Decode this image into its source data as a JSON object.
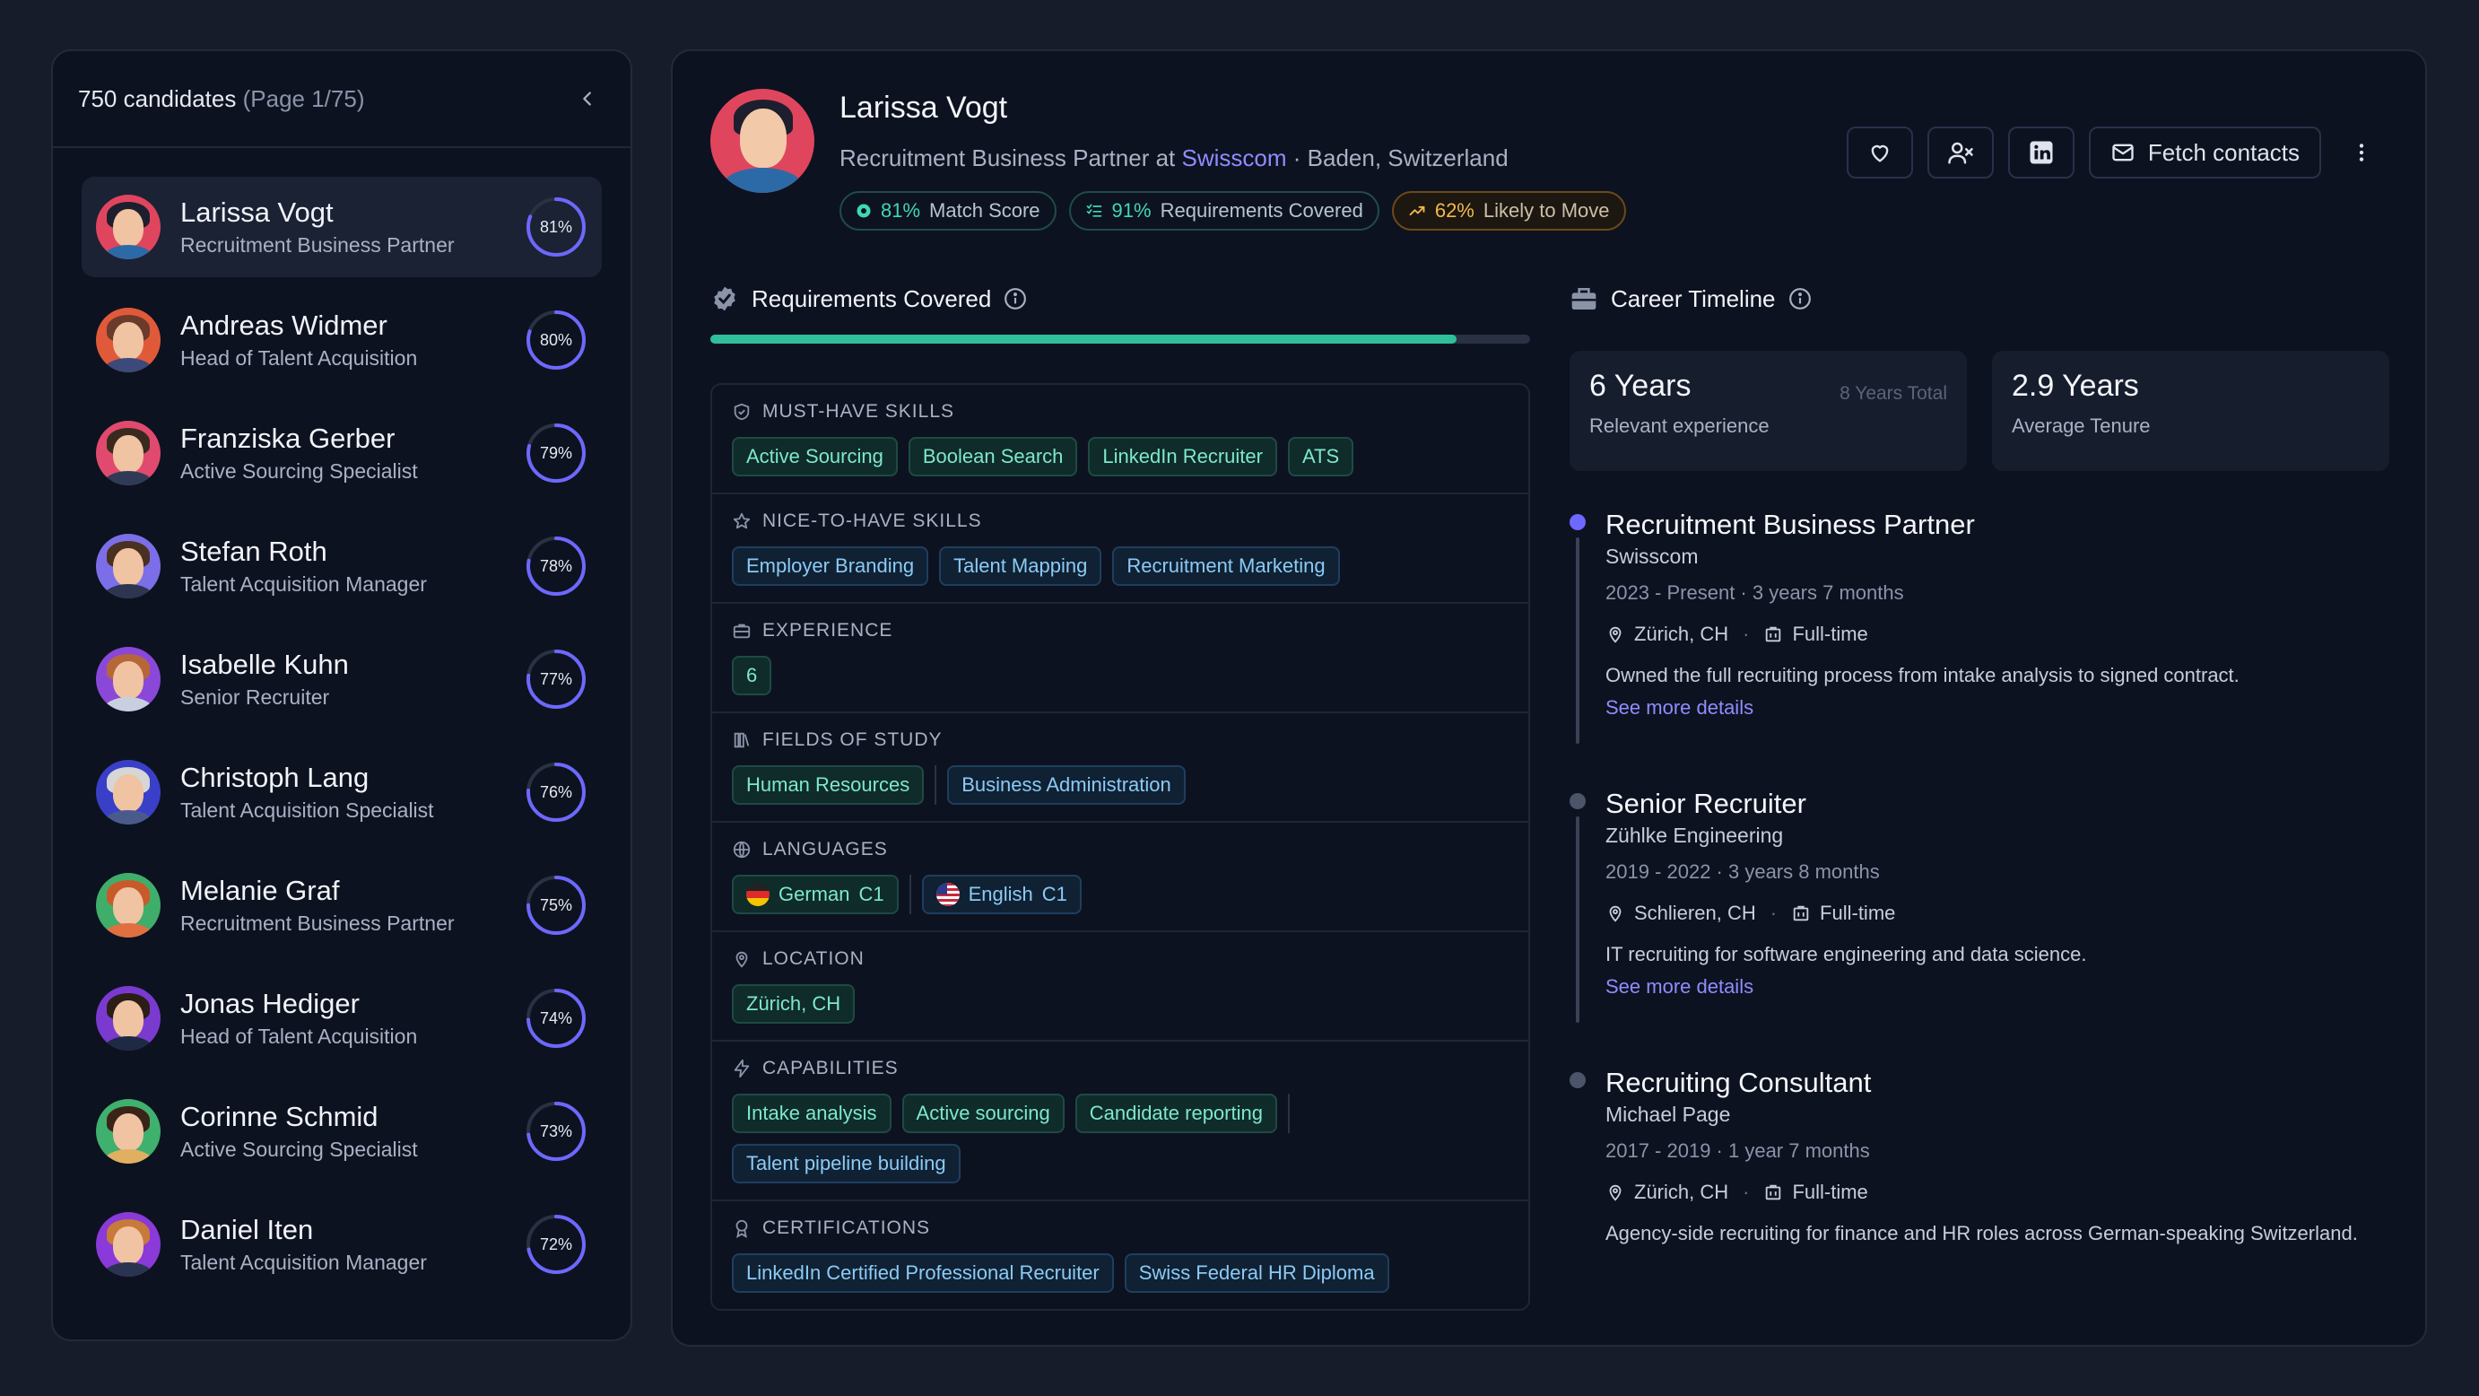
{
  "sidebar": {
    "count_text": "750 candidates",
    "page_text": "(Page 1/75)",
    "candidates": [
      {
        "name": "Larissa Vogt",
        "role": "Recruitment Business Partner",
        "score": "81%",
        "pct": 81,
        "bg": "#e0455e",
        "hair": "#1d1f2e",
        "shirt": "#2c6aa7"
      },
      {
        "name": "Andreas Widmer",
        "role": "Head of Talent Acquisition",
        "score": "80%",
        "pct": 80,
        "bg": "#e05a3a",
        "hair": "#6b3a2a",
        "shirt": "#3b4a7a"
      },
      {
        "name": "Franziska Gerber",
        "role": "Active Sourcing Specialist",
        "score": "79%",
        "pct": 79,
        "bg": "#e04a6e",
        "hair": "#3a2a1e",
        "shirt": "#2f3a56"
      },
      {
        "name": "Stefan Roth",
        "role": "Talent Acquisition Manager",
        "score": "78%",
        "pct": 78,
        "bg": "#7c6ee8",
        "hair": "#4a3020",
        "shirt": "#2d3550"
      },
      {
        "name": "Isabelle Kuhn",
        "role": "Senior Recruiter",
        "score": "77%",
        "pct": 77,
        "bg": "#8a48d8",
        "hair": "#b5673a",
        "shirt": "#c8d0e0"
      },
      {
        "name": "Christoph Lang",
        "role": "Talent Acquisition Specialist",
        "score": "76%",
        "pct": 76,
        "bg": "#3a3fc8",
        "hair": "#d6d6d6",
        "shirt": "#4a5a8a"
      },
      {
        "name": "Melanie Graf",
        "role": "Recruitment Business Partner",
        "score": "75%",
        "pct": 75,
        "bg": "#3fae6a",
        "hair": "#c85a2a",
        "shirt": "#e07040"
      },
      {
        "name": "Jonas Hediger",
        "role": "Head of Talent Acquisition",
        "score": "74%",
        "pct": 74,
        "bg": "#7a3ad0",
        "hair": "#2a1e16",
        "shirt": "#1e2a44"
      },
      {
        "name": "Corinne Schmid",
        "role": "Active Sourcing Specialist",
        "score": "73%",
        "pct": 73,
        "bg": "#3fb06e",
        "hair": "#3a2418",
        "shirt": "#e0b060"
      },
      {
        "name": "Daniel Iten",
        "role": "Talent Acquisition Manager",
        "score": "72%",
        "pct": 72,
        "bg": "#8a3ad8",
        "hair": "#c87a3a",
        "shirt": "#2a3350"
      }
    ]
  },
  "profile": {
    "name": "Larissa Vogt",
    "role_prefix": "Recruitment Business Partner at",
    "company": "Swisscom",
    "location": "· Baden, Switzerland",
    "badges": {
      "match_pct": "81%",
      "match_label": "Match Score",
      "req_pct": "91%",
      "req_label": "Requirements Covered",
      "move_pct": "62%",
      "move_label": "Likely to Move"
    },
    "actions": {
      "fetch_label": "Fetch contacts"
    }
  },
  "requirements": {
    "title": "Requirements Covered",
    "progress": 0.91,
    "sections": {
      "must_have": {
        "label": "MUST-HAVE SKILLS",
        "tags": [
          "Active Sourcing",
          "Boolean Search",
          "LinkedIn Recruiter",
          "ATS"
        ]
      },
      "nice_to_have": {
        "label": "NICE-TO-HAVE SKILLS",
        "tags": [
          "Employer Branding",
          "Talent Mapping",
          "Recruitment Marketing"
        ]
      },
      "experience": {
        "label": "EXPERIENCE",
        "value": "6"
      },
      "fields": {
        "label": "FIELDS OF STUDY",
        "tags": [
          "Human Resources",
          "Business Administration"
        ]
      },
      "languages": {
        "label": "LANGUAGES",
        "items": [
          {
            "name": "German",
            "level": "C1"
          },
          {
            "name": "English",
            "level": "C1"
          }
        ]
      },
      "location": {
        "label": "LOCATION",
        "value": "Zürich, CH"
      },
      "capabilities": {
        "label": "CAPABILITIES",
        "tags": [
          "Intake analysis",
          "Active sourcing",
          "Candidate reporting",
          "Talent pipeline building"
        ]
      },
      "certifications": {
        "label": "CERTIFICATIONS",
        "tags": [
          "LinkedIn Certified Professional Recruiter",
          "Swiss Federal HR Diploma"
        ]
      }
    }
  },
  "career": {
    "title": "Career Timeline",
    "relevant": {
      "value": "6 Years",
      "total": "8 Years Total",
      "label": "Relevant experience"
    },
    "tenure": {
      "value": "2.9 Years",
      "label": "Average Tenure"
    },
    "jobs": [
      {
        "title": "Recruitment Business Partner",
        "company": "Swisscom",
        "dates": "2023 - Present · 3 years 7 months",
        "location": "Zürich, CH",
        "type": "Full-time",
        "desc": "Owned the full recruiting process from intake analysis to signed contract.",
        "link": "See more details"
      },
      {
        "title": "Senior Recruiter",
        "company": "Zühlke Engineering",
        "dates": "2019 - 2022 · 3 years 8 months",
        "location": "Schlieren, CH",
        "type": "Full-time",
        "desc": "IT recruiting for software engineering and data science.",
        "link": "See more details"
      },
      {
        "title": "Recruiting Consultant",
        "company": "Michael Page",
        "dates": "2017 - 2019 · 1 year 7 months",
        "location": "Zürich, CH",
        "type": "Full-time",
        "desc": "Agency-side recruiting for finance and HR roles across German-speaking Switzerland."
      }
    ]
  },
  "colors": {
    "accent": "#6d68ff",
    "teal": "#2fbf9b",
    "amber": "#f2b84b",
    "background": "#171c2b",
    "panel": "#0d1220"
  }
}
